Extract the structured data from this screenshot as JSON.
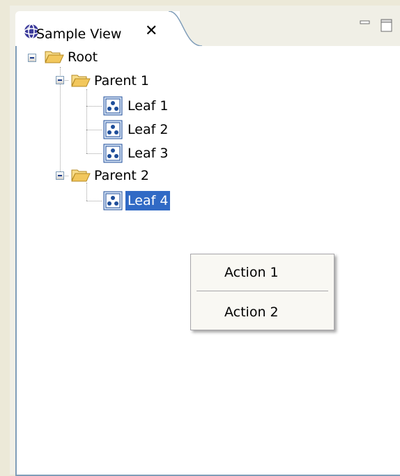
{
  "view": {
    "title": "Sample View",
    "close_symbol": "✕",
    "icons": {
      "view_icon": "globe-icon",
      "minimize": "minimize-icon",
      "maximize": "maximize-icon"
    }
  },
  "tree": {
    "root": {
      "label": "Root",
      "expanded": true
    },
    "parents": [
      {
        "label": "Parent 1",
        "expanded": true,
        "children": [
          "Leaf 1",
          "Leaf 2",
          "Leaf 3"
        ]
      },
      {
        "label": "Parent 2",
        "expanded": true,
        "children": [
          "Leaf 4"
        ]
      }
    ],
    "selected": "Leaf 4"
  },
  "context_menu": {
    "items": [
      {
        "label": "Action 1"
      },
      {
        "label": "Action 2"
      }
    ]
  },
  "colors": {
    "selection": "#316ac5",
    "border": "#7f9db9",
    "folder": "#f2c75c"
  }
}
